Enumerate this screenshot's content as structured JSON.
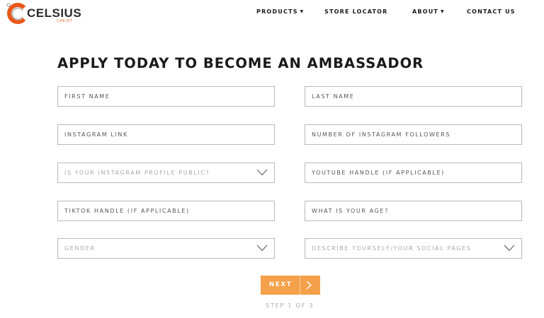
{
  "brand": {
    "name": "CELSIUS",
    "tagline": "LIVE FIT",
    "color": "#e8581a"
  },
  "nav": {
    "products": "PRODUCTS",
    "store_locator": "STORE LOCATOR",
    "about": "ABOUT",
    "contact": "CONTACT US"
  },
  "form": {
    "title": "APPLY TODAY TO BECOME AN AMBASSADOR",
    "fields": {
      "first_name": "FIRST NAME",
      "last_name": "LAST NAME",
      "instagram_link": "INSTAGRAM LINK",
      "instagram_followers": "NUMBER OF INSTAGRAM FOLLOWERS",
      "instagram_public": "IS YOUR INSTAGRAM PROFILE PUBLIC?",
      "youtube_handle": "YOUTUBE HANDLE (IF APPLICABLE)",
      "tiktok_handle": "TIKTOK HANDLE (IF APPLICABLE)",
      "age": "WHAT IS YOUR AGE?",
      "gender": "GENDER",
      "describe": "DESCRIBE YOURSELF/YOUR SOCIAL PAGES"
    },
    "next_label": "NEXT",
    "step_text": "STEP 1 OF 3",
    "accent_color": "#f5a04a"
  }
}
